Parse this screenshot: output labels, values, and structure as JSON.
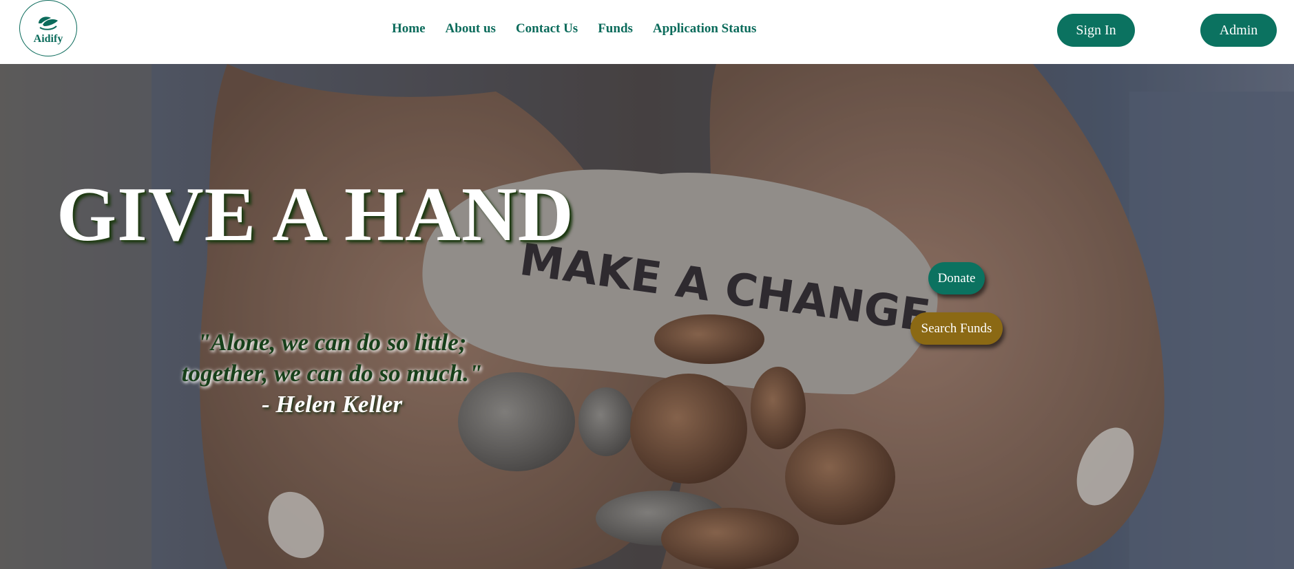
{
  "brand": {
    "name": "Aidify",
    "logo_icon": "leaf-hands-icon",
    "accent_color": "#0b6b5b"
  },
  "nav": {
    "links": [
      {
        "label": "Home"
      },
      {
        "label": "About us"
      },
      {
        "label": "Contact Us"
      },
      {
        "label": "Funds"
      },
      {
        "label": "Application Status"
      }
    ],
    "signin_label": "Sign In",
    "admin_label": "Admin"
  },
  "hero": {
    "title": "GIVE A HAND",
    "note_text": "MAKE A CHANGE",
    "quote_line1": "\"Alone, we can do so little;",
    "quote_line2": "together, we can do so much.\"",
    "quote_author": "- Helen Keller",
    "donate_label": "Donate",
    "search_funds_label": "Search Funds",
    "donate_color": "#0b7260",
    "search_color": "#8b6914"
  }
}
